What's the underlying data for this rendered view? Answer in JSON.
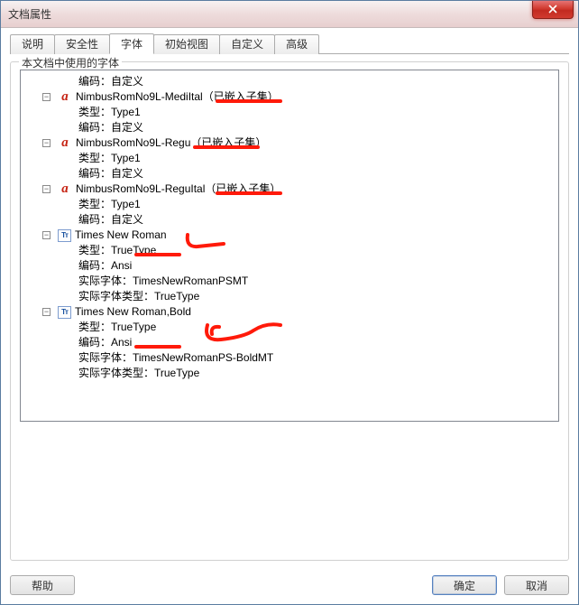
{
  "window": {
    "title": "文档属性"
  },
  "tabs": [
    {
      "label": "说明"
    },
    {
      "label": "安全性"
    },
    {
      "label": "字体",
      "active": true
    },
    {
      "label": "初始视图"
    },
    {
      "label": "自定义"
    },
    {
      "label": "高级"
    }
  ],
  "fieldset": {
    "label": "本文档中使用的字体"
  },
  "tree": {
    "top_detail": "编码：自定义",
    "items": [
      {
        "icon": "serif",
        "name": "NimbusRomNo9L-MediItal（已嵌入子集）",
        "details": [
          "类型：Type1",
          "编码：自定义"
        ]
      },
      {
        "icon": "serif",
        "name": "NimbusRomNo9L-Regu（已嵌入子集）",
        "details": [
          "类型：Type1",
          "编码：自定义"
        ]
      },
      {
        "icon": "serif",
        "name": "NimbusRomNo9L-ReguItal（已嵌入子集）",
        "details": [
          "类型：Type1",
          "编码：自定义"
        ]
      },
      {
        "icon": "tt",
        "name": "Times New Roman",
        "details": [
          "类型：TrueType",
          "编码：Ansi",
          "实际字体：TimesNewRomanPSMT",
          "实际字体类型：TrueType"
        ]
      },
      {
        "icon": "tt",
        "name": "Times New Roman,Bold",
        "details": [
          "类型：TrueType",
          "编码：Ansi",
          "实际字体：TimesNewRomanPS-BoldMT",
          "实际字体类型：TrueType"
        ]
      }
    ]
  },
  "buttons": {
    "help": "帮助",
    "ok": "确定",
    "cancel": "取消"
  },
  "expander_glyph": "−",
  "icons": {
    "serif_glyph": "a",
    "tt_glyph": "Tᴛ"
  }
}
